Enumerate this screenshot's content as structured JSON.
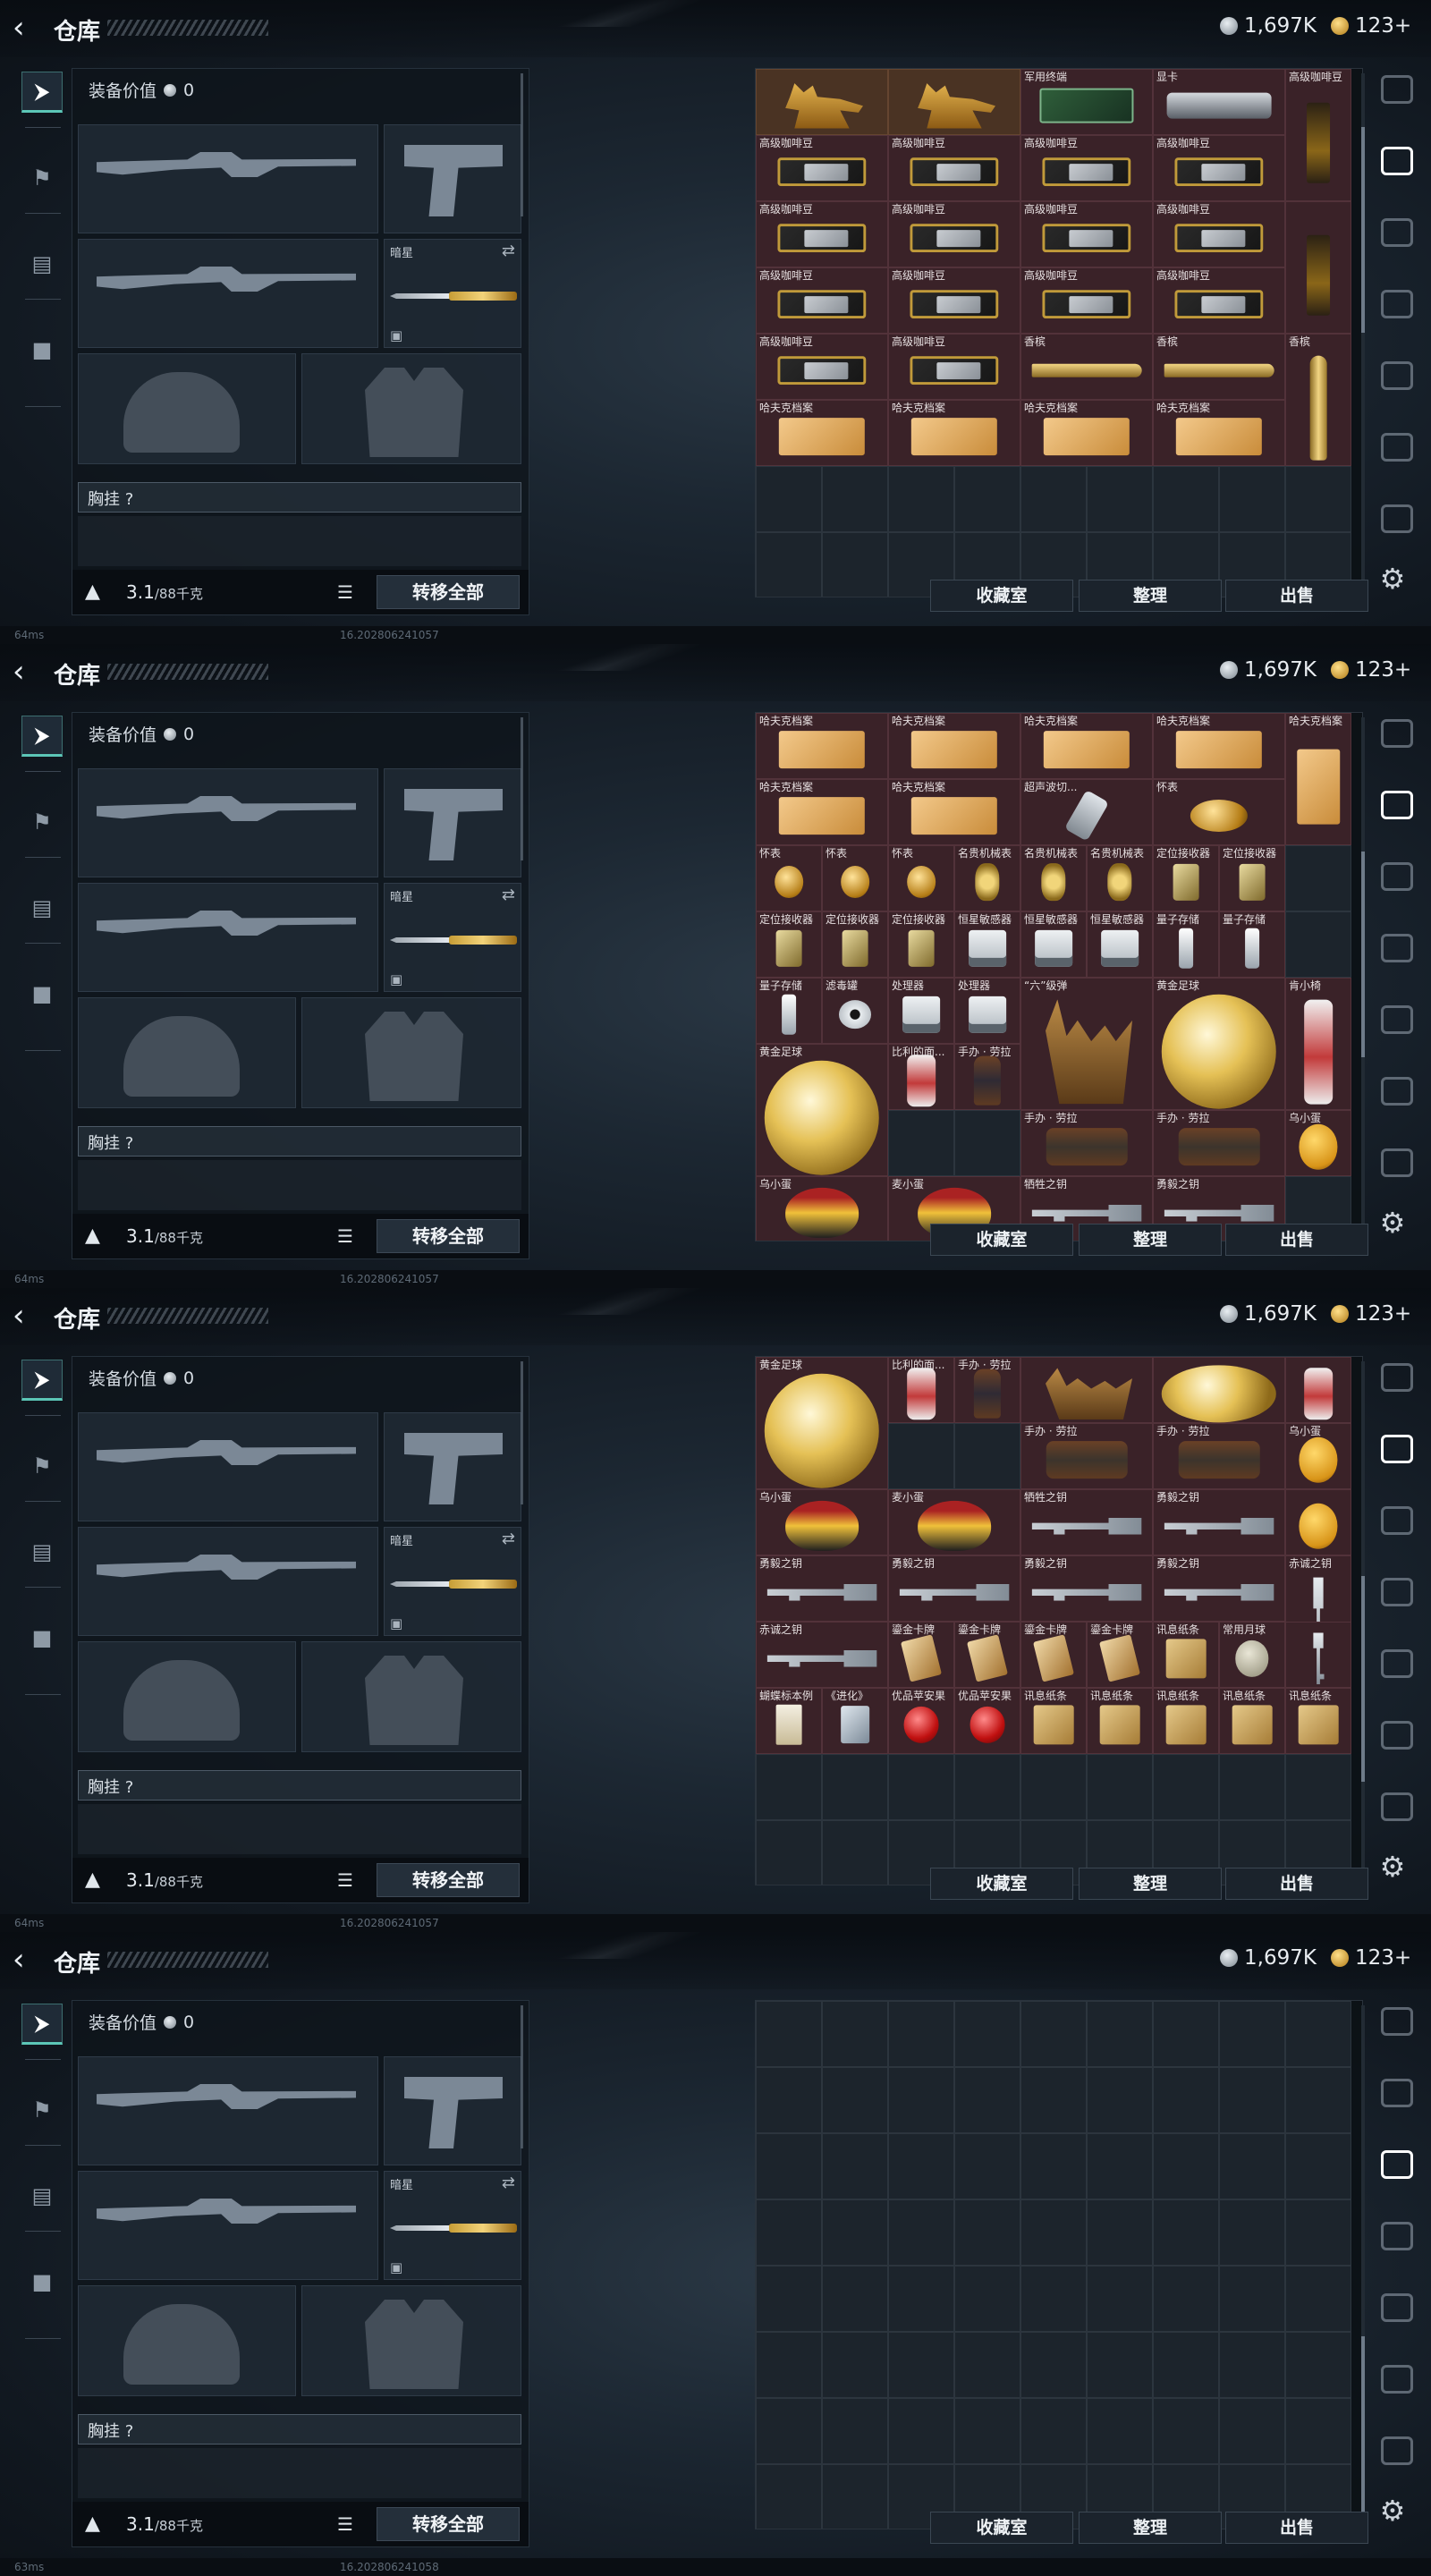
{
  "header": {
    "title": "仓库",
    "silver": "1,697K",
    "gold": "123+"
  },
  "left_panel": {
    "value_label": "装备价值",
    "value": "0",
    "melee_name": "暗星",
    "chest_label": "胸挂",
    "chest_hint": "?",
    "weight": "3.1",
    "weight_max": "/88千克",
    "transfer_all": "转移全部"
  },
  "nav_icons": [
    "weapon-icon",
    "helmet-icon",
    "vest-icon",
    "backpack-icon"
  ],
  "right_sidebar_icons": [
    "safe-icon",
    "storage-icon",
    "storage-icon",
    "storage-icon",
    "storage-icon",
    "storage-icon",
    "storage-icon"
  ],
  "buttons": {
    "collection": "收藏室",
    "sort": "整理",
    "sell": "出售"
  },
  "frames": [
    {
      "footer_ping": "64ms",
      "footer_ver": "16.20280624105?",
      "grid_rows": [
        [
          {
            "n": "",
            "a": "deer",
            "w": 1,
            "h": 2,
            "c": "gold"
          },
          {
            "n": "",
            "a": "deer",
            "w": 1,
            "h": 2,
            "c": "gold"
          },
          {
            "n": "军用终端",
            "a": "board",
            "w": 1,
            "h": 1
          },
          {
            "n": "显卡",
            "a": "gpu",
            "w": 2,
            "h": 1
          },
          {
            "n": "高级咖啡豆",
            "a": "coffeebag",
            "w": 1,
            "h": 2
          }
        ],
        [
          {
            "n": "高级咖啡豆",
            "a": "coffee"
          },
          {
            "n": "高级咖啡豆",
            "a": "coffee"
          },
          {
            "n": "高级咖啡豆",
            "a": "coffee"
          },
          {
            "n": "高级咖啡豆",
            "a": "coffee"
          }
        ],
        [
          {
            "n": "高级咖啡豆",
            "a": "coffee"
          },
          {
            "n": "高级咖啡豆",
            "a": "coffee"
          },
          {
            "n": "高级咖啡豆",
            "a": "coffee"
          },
          {
            "n": "高级咖啡豆",
            "a": "coffee"
          },
          {
            "n": "",
            "a": "coffeebag"
          }
        ],
        [
          {
            "n": "高级咖啡豆",
            "a": "coffee"
          },
          {
            "n": "高级咖啡豆",
            "a": "coffee"
          },
          {
            "n": "高级咖啡豆",
            "a": "coffee"
          },
          {
            "n": "高级咖啡豆",
            "a": "coffee"
          }
        ],
        [
          {
            "n": "高级咖啡豆",
            "a": "coffee"
          },
          {
            "n": "高级咖啡豆",
            "a": "coffee"
          },
          {
            "n": "香槟",
            "a": "wineh"
          },
          {
            "n": "香槟",
            "a": "wineh"
          },
          {
            "n": "香槟",
            "a": "wine"
          }
        ],
        [
          {
            "n": "哈夫克档案",
            "a": "file"
          },
          {
            "n": "哈夫克档案",
            "a": "file"
          },
          {
            "n": "哈夫克档案",
            "a": "file"
          },
          {
            "n": "哈夫克档案",
            "a": "file"
          }
        ]
      ]
    }
  ],
  "items_frame2": [
    {
      "n": "哈夫克档案",
      "a": "file"
    },
    {
      "n": "哈夫克档案",
      "a": "file"
    },
    {
      "n": "哈夫克档案",
      "a": "file"
    },
    {
      "n": "哈夫克档案",
      "a": "file"
    },
    {
      "n": "哈夫克档案",
      "a": "file"
    },
    {
      "n": "哈夫克档案",
      "a": "file"
    },
    {
      "n": "哈夫克档案",
      "a": "file"
    },
    {
      "n": "超声波切...",
      "a": "pen"
    },
    {
      "n": "怀表",
      "a": "pocket"
    },
    {
      "n": "怀表",
      "a": "pocket"
    },
    {
      "n": "怀表",
      "a": "pocket"
    },
    {
      "n": "怀表",
      "a": "pocket"
    },
    {
      "n": "名贵机械表",
      "a": "watch"
    },
    {
      "n": "名贵机械表",
      "a": "watch"
    },
    {
      "n": "名贵机械表",
      "a": "watch"
    },
    {
      "n": "定位接收器",
      "a": "locator"
    },
    {
      "n": "定位接收器",
      "a": "locator"
    },
    {
      "n": "定位接收器",
      "a": "locator"
    },
    {
      "n": "定位接收器",
      "a": "locator"
    },
    {
      "n": "定位接收器",
      "a": "locator"
    },
    {
      "n": "恒星敏感器",
      "a": "device"
    },
    {
      "n": "恒星敏感器",
      "a": "device"
    },
    {
      "n": "恒星敏感器",
      "a": "device"
    },
    {
      "n": "量子存储",
      "a": "usb"
    },
    {
      "n": "量子存储",
      "a": "usb"
    },
    {
      "n": "量子存储",
      "a": "usb"
    },
    {
      "n": "滤毒罐",
      "a": "tape"
    },
    {
      "n": "处理器",
      "a": "device"
    },
    {
      "n": "处理器",
      "a": "device"
    },
    {
      "n": "“六”级弹",
      "a": "hand"
    },
    {
      "n": "黄金足球",
      "a": "ball"
    },
    {
      "n": "肯小椅",
      "a": "robot"
    },
    {
      "n": "黄金足球",
      "a": "ball"
    },
    {
      "n": "比利的面...",
      "a": "robot"
    },
    {
      "n": "手办 · 劳拉",
      "a": "figure"
    },
    {
      "n": "手办 · 劳拉",
      "a": "figure2"
    },
    {
      "n": "手办 · 劳拉",
      "a": "figure2"
    },
    {
      "n": "乌小蛋",
      "a": "egg2"
    },
    {
      "n": "乌小蛋",
      "a": "egg"
    },
    {
      "n": "麦小蛋",
      "a": "egg"
    },
    {
      "n": "牺牲之钥",
      "a": "key"
    },
    {
      "n": "勇毅之钥",
      "a": "key"
    }
  ],
  "items_frame3": [
    {
      "n": "黄金足球",
      "a": "ball"
    },
    {
      "n": "比利的面...",
      "a": "robot"
    },
    {
      "n": "手办 · 劳拉",
      "a": "figure"
    },
    {
      "n": "",
      "a": "hand"
    },
    {
      "n": "",
      "a": "ball"
    },
    {
      "n": "",
      "a": "robot"
    },
    {
      "n": "手办 · 劳拉",
      "a": "figure2"
    },
    {
      "n": "手办 · 劳拉",
      "a": "figure2"
    },
    {
      "n": "乌小蛋",
      "a": "egg2"
    },
    {
      "n": "乌小蛋",
      "a": "egg"
    },
    {
      "n": "麦小蛋",
      "a": "egg"
    },
    {
      "n": "牺牲之钥",
      "a": "key"
    },
    {
      "n": "勇毅之钥",
      "a": "key"
    },
    {
      "n": "",
      "a": "egg2"
    },
    {
      "n": "勇毅之钥",
      "a": "key"
    },
    {
      "n": "勇毅之钥",
      "a": "key"
    },
    {
      "n": "勇毅之钥",
      "a": "key"
    },
    {
      "n": "勇毅之钥",
      "a": "key"
    },
    {
      "n": "赤诚之钥",
      "a": "keyv"
    },
    {
      "n": "赤诚之钥",
      "a": "key"
    },
    {
      "n": "鎏金卡牌",
      "a": "card"
    },
    {
      "n": "鎏金卡牌",
      "a": "card"
    },
    {
      "n": "鎏金卡牌",
      "a": "card"
    },
    {
      "n": "鎏金卡牌",
      "a": "card"
    },
    {
      "n": "讯息纸条",
      "a": "note"
    },
    {
      "n": "常用月球",
      "a": "moon"
    },
    {
      "n": "",
      "a": "keyv"
    },
    {
      "n": "蝴蝶标本例",
      "a": "cert"
    },
    {
      "n": "《进化》",
      "a": "cd"
    },
    {
      "n": "优品苹安果",
      "a": "apple"
    },
    {
      "n": "优品苹安果",
      "a": "apple"
    },
    {
      "n": "讯息纸条",
      "a": "note"
    },
    {
      "n": "讯息纸条",
      "a": "note"
    },
    {
      "n": "讯息纸条",
      "a": "note"
    },
    {
      "n": "讯息纸条",
      "a": "note"
    },
    {
      "n": "讯息纸条",
      "a": "note"
    }
  ],
  "footers": [
    {
      "ping": "64ms",
      "ver": "16.202806241057"
    },
    {
      "ping": "64ms",
      "ver": "16.202806241057"
    },
    {
      "ping": "64ms",
      "ver": "16.202806241057"
    },
    {
      "ping": "63ms",
      "ver": "16.202806241058"
    }
  ]
}
